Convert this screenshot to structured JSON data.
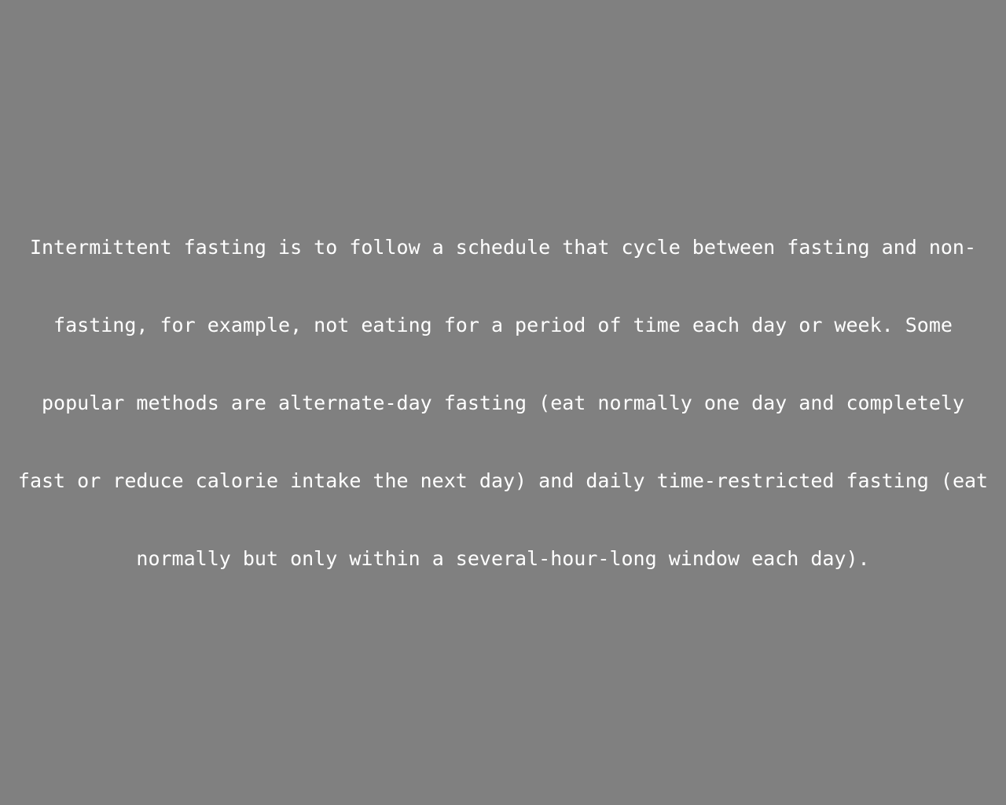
{
  "colors": {
    "background": "#808080",
    "text": "#ffffff"
  },
  "paragraph": {
    "lines": [
      "Intermittent fasting is to follow a schedule that cycle between fasting and non-",
      "fasting, for example, not eating for a period of time each day or week. Some",
      "popular methods are alternate-day fasting (eat normally one day and completely",
      "fast or reduce calorie intake the next day) and daily time-restricted fasting (eat",
      "normally but only within a several-hour-long window each day)."
    ]
  }
}
